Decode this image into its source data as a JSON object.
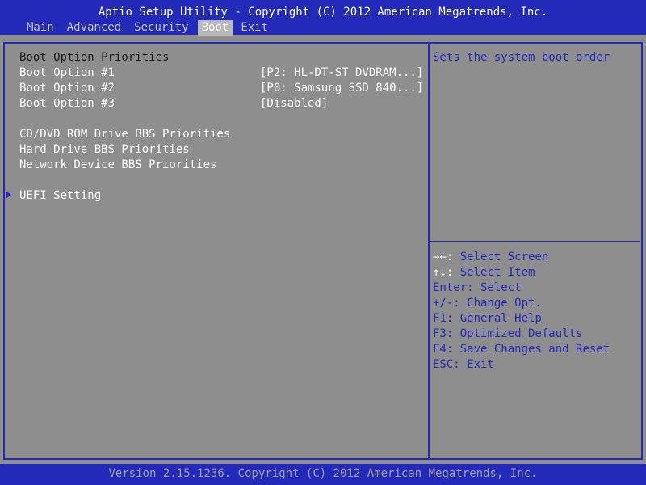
{
  "header": {
    "title": "Aptio Setup Utility - Copyright (C) 2012 American Megatrends, Inc.",
    "tabs": [
      {
        "label": "Main",
        "active": false
      },
      {
        "label": "Advanced",
        "active": false
      },
      {
        "label": "Security",
        "active": false
      },
      {
        "label": "Boot",
        "active": true
      },
      {
        "label": "Exit",
        "active": false
      }
    ]
  },
  "main": {
    "section_title": "Boot Option Priorities",
    "boot_options": [
      {
        "label": "Boot Option #1",
        "value": "[P2: HL-DT-ST DVDRAM...]"
      },
      {
        "label": "Boot Option #2",
        "value": "[P0: Samsung SSD 840...]"
      },
      {
        "label": "Boot Option #3",
        "value": "[Disabled]"
      }
    ],
    "bbs_items": [
      "CD/DVD ROM Drive BBS Priorities",
      "Hard Drive BBS Priorities",
      "Network Device BBS Priorities"
    ],
    "submenu": {
      "label": "UEFI Setting",
      "icon": "triangle-right-icon"
    }
  },
  "help": {
    "description": "Sets the system boot order",
    "keys": [
      {
        "key": "→←:",
        "text": " Select Screen"
      },
      {
        "key": "↑↓:",
        "text": " Select Item"
      },
      {
        "key": "Enter:",
        "text": " Select"
      },
      {
        "key": "+/-:",
        "text": " Change Opt."
      },
      {
        "key": "F1:",
        "text": " General Help"
      },
      {
        "key": "F3:",
        "text": " Optimized Defaults"
      },
      {
        "key": "F4:",
        "text": " Save Changes and Reset"
      },
      {
        "key": "ESC:",
        "text": " Exit"
      }
    ]
  },
  "footer": {
    "version": "Version 2.15.1236. Copyright (C) 2012 American Megatrends, Inc."
  },
  "colors": {
    "background": "#8e8e8e",
    "accent": "#2329b8",
    "selected_tab": "#b8b8b8"
  }
}
